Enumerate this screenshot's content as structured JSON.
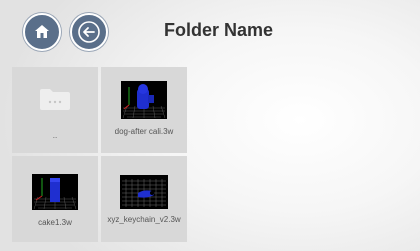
{
  "header": {
    "title": "Folder Name",
    "home_icon": "home-icon",
    "back_icon": "back-arrow-icon"
  },
  "files": [
    {
      "label": "..",
      "type": "folder-up",
      "icon": "folder-icon"
    },
    {
      "label": "dog-after cali.3w",
      "type": "model",
      "icon": "model-thumbnail"
    },
    {
      "label": "cake1.3w",
      "type": "model",
      "icon": "model-thumbnail"
    },
    {
      "label": "xyz_keychain_v2.3w",
      "type": "model",
      "icon": "model-thumbnail"
    }
  ],
  "colors": {
    "button_fill": "#5a6f8a",
    "tile_bg": "#d8d8d8",
    "model_blue": "#1f2fd0"
  }
}
